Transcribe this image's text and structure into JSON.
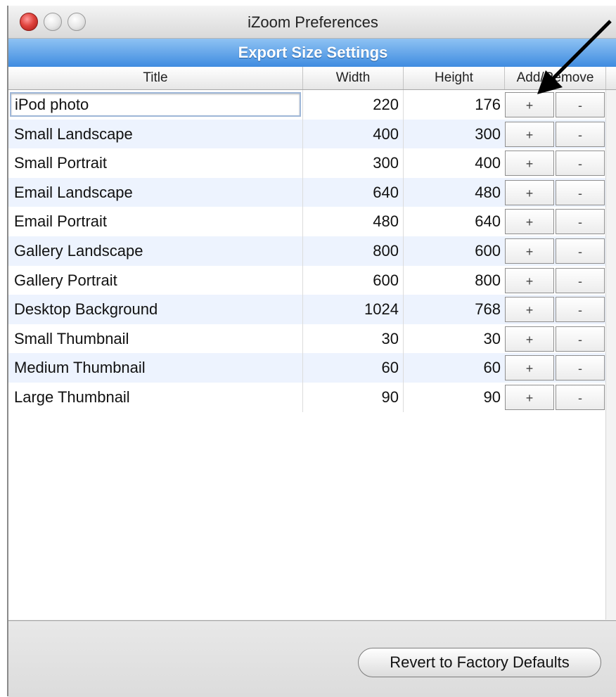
{
  "window": {
    "title": "iZoom Preferences"
  },
  "section": {
    "title": "Export Size Settings"
  },
  "table": {
    "columns": [
      "Title",
      "Width",
      "Height",
      "Add/Remove"
    ],
    "add_label": "+",
    "remove_label": "-",
    "rows": [
      {
        "title": "iPod photo",
        "width": "220",
        "height": "176"
      },
      {
        "title": "Small Landscape",
        "width": "400",
        "height": "300"
      },
      {
        "title": "Small Portrait",
        "width": "300",
        "height": "400"
      },
      {
        "title": "Email Landscape",
        "width": "640",
        "height": "480"
      },
      {
        "title": "Email Portrait",
        "width": "480",
        "height": "640"
      },
      {
        "title": "Gallery Landscape",
        "width": "800",
        "height": "600"
      },
      {
        "title": "Gallery Portrait",
        "width": "600",
        "height": "800"
      },
      {
        "title": "Desktop Background",
        "width": "1024",
        "height": "768"
      },
      {
        "title": "Small Thumbnail",
        "width": "30",
        "height": "30"
      },
      {
        "title": "Medium Thumbnail",
        "width": "60",
        "height": "60"
      },
      {
        "title": "Large Thumbnail",
        "width": "90",
        "height": "90"
      }
    ]
  },
  "footer": {
    "revert_label": "Revert to Factory Defaults"
  }
}
